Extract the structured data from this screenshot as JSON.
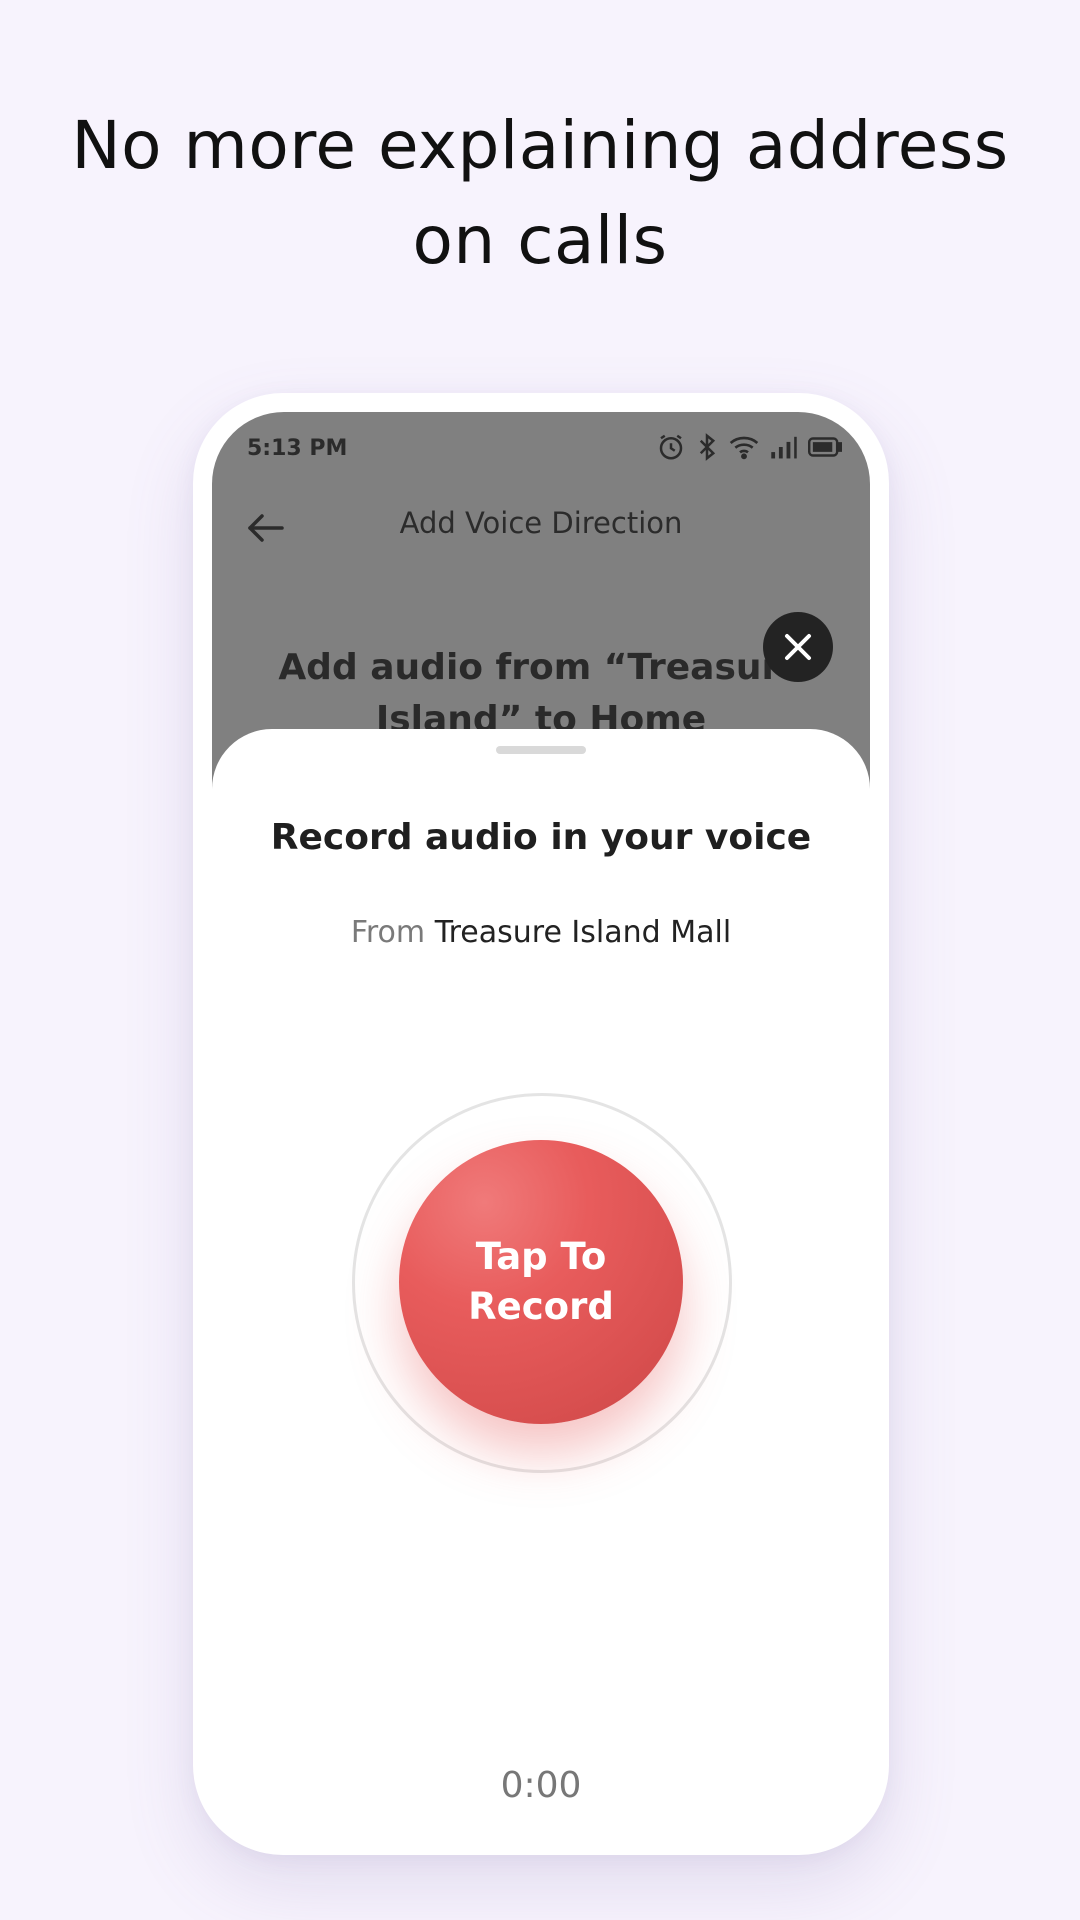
{
  "headline": "No more explaining address on calls",
  "status_bar": {
    "time": "5:13 PM",
    "icons": [
      "alarm-icon",
      "bluetooth-icon",
      "wifi-icon",
      "signal-icon",
      "battery-icon"
    ]
  },
  "app_bar": {
    "back_icon": "arrow-left-icon",
    "title": "Add Voice Direction"
  },
  "background_heading": "Add audio from “Treasure Island” to Home",
  "close_icon": "close-icon",
  "sheet": {
    "title": "Record audio in your voice",
    "from_label": "From",
    "from_place": "Treasure Island Mall",
    "record_button_label": "Tap To Record",
    "timer": "0:00"
  },
  "colors": {
    "page_background": "#f7f3fd",
    "record_button": "#e85c5c",
    "scrim": "#808080",
    "close_button": "#232323"
  }
}
